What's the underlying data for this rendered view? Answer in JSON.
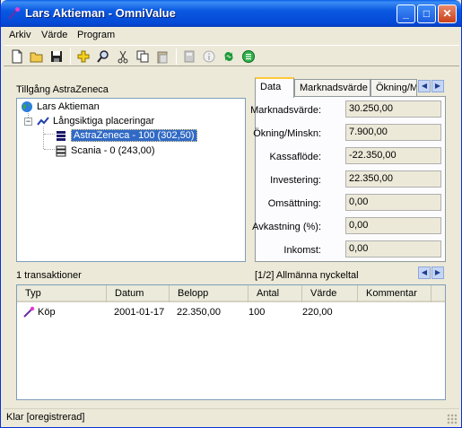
{
  "window": {
    "title": "Lars Aktieman - OmniValue",
    "controls": {
      "minimize": "_",
      "maximize": "□",
      "close": "✕"
    }
  },
  "menu": [
    "Arkiv",
    "Värde",
    "Program"
  ],
  "toolbar": {
    "icons": [
      "new-icon",
      "open-folder-icon",
      "save-icon",
      "add-icon",
      "search-icon",
      "cut-icon",
      "copy-icon",
      "paste-icon",
      "calculator-icon",
      "info-icon",
      "refresh-icon",
      "list-icon"
    ]
  },
  "tree_panel": {
    "label": "Tillgång AstraZeneca",
    "root": "Lars Aktieman",
    "group": "Långsiktiga placeringar",
    "items": [
      {
        "label": "AstraZeneca - 100 (302,50)",
        "selected": true
      },
      {
        "label": "Scania - 0 (243,00)",
        "selected": false
      }
    ]
  },
  "tabs": {
    "items": [
      "Data",
      "Marknadsvärde",
      "Ökning/Minskn"
    ],
    "active": "Data",
    "fields": [
      {
        "label": "Marknadsvärde:",
        "value": "30.250,00"
      },
      {
        "label": "Ökning/Minskn:",
        "value": "7.900,00"
      },
      {
        "label": "Kassaflöde:",
        "value": "-22.350,00"
      },
      {
        "label": "Investering:",
        "value": "22.350,00"
      },
      {
        "label": "Omsättning:",
        "value": "0,00"
      },
      {
        "label": "Avkastning (%):",
        "value": "0,00"
      },
      {
        "label": "Inkomst:",
        "value": "0,00"
      }
    ]
  },
  "transactions": {
    "count_label": "1 transaktioner",
    "page_label": "[1/2] Allmänna nyckeltal",
    "columns": [
      "Typ",
      "Datum",
      "Belopp",
      "Antal",
      "Värde",
      "Kommentar"
    ],
    "rows": [
      {
        "typ": "Köp",
        "datum": "2001-01-17",
        "belopp": "22.350,00",
        "antal": "100",
        "varde": "220,00",
        "kommentar": ""
      }
    ]
  },
  "status": {
    "text": "Klar [oregistrerad]"
  },
  "colors": {
    "title_bar": "#0a58e0",
    "selection": "#316ac5",
    "accent_tab": "#ffc83c"
  }
}
